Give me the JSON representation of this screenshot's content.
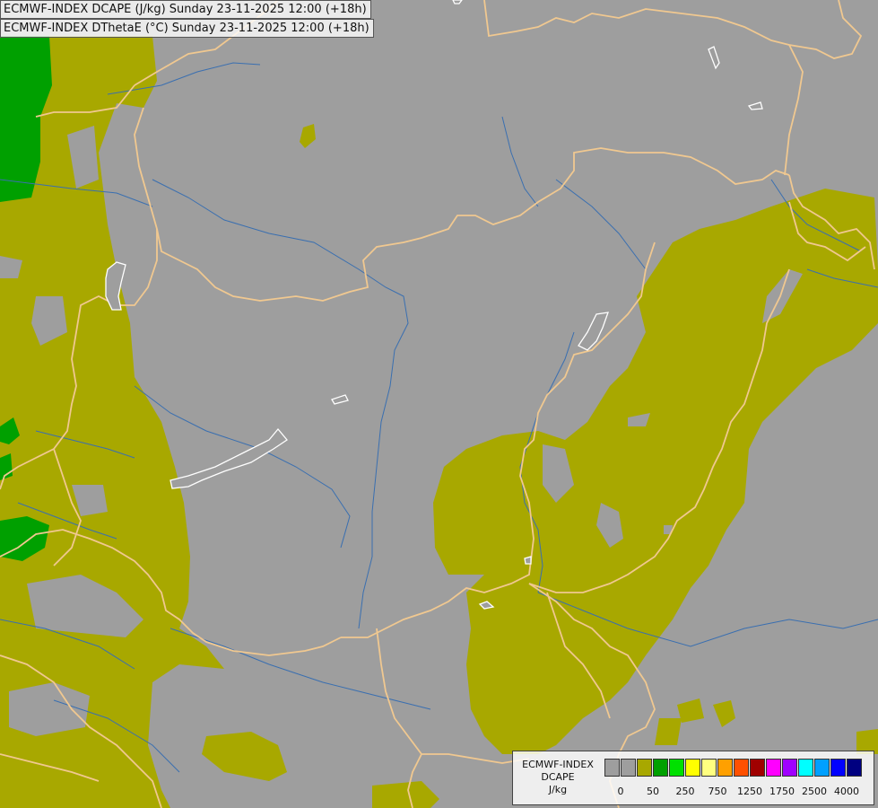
{
  "titles": {
    "line1": "ECMWF-INDEX DCAPE (J/kg) Sunday 23-11-2025 12:00 (+18h)",
    "line2": "ECMWF-INDEX DThetaE (°C) Sunday 23-11-2025 12:00 (+18h)"
  },
  "legend": {
    "label_line1": "ECMWF-INDEX",
    "label_line2": "DCAPE",
    "label_line3": "J/kg",
    "colors": [
      "#9e9e9e",
      "#9e9e9e",
      "#a8a800",
      "#00a000",
      "#00e000",
      "#ffff00",
      "#ffff80",
      "#ffa000",
      "#ff5000",
      "#a00000",
      "#ff00ff",
      "#a000ff",
      "#00ffff",
      "#00a0ff",
      "#0000ff",
      "#000080"
    ],
    "tick_labels": [
      "0",
      "50",
      "250",
      "750",
      "1250",
      "1750",
      "2500",
      "4000"
    ]
  },
  "colors": {
    "background": "#9e9e9e",
    "dcape_low": "#a8a800",
    "dcape_mid": "#00a000",
    "border": "#f0c890",
    "river": "#3a6fb0",
    "lake": "#ffffff"
  }
}
